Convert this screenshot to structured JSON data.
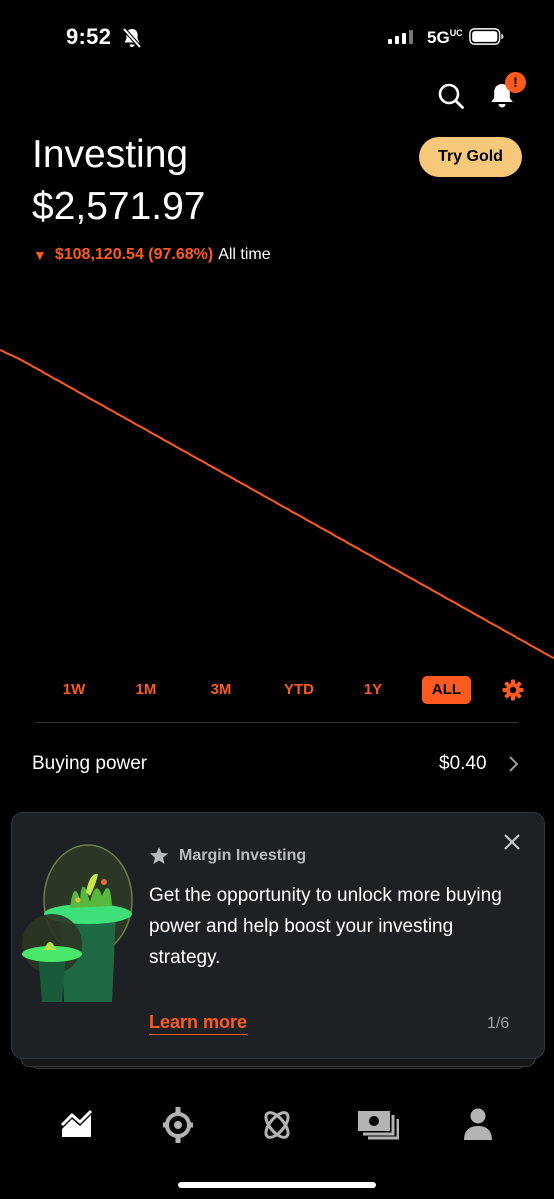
{
  "status_bar": {
    "time": "9:52",
    "network": "5G",
    "network_sub": "UC"
  },
  "header": {
    "title": "Investing",
    "gold_button": "Try Gold",
    "notification_badge": "!"
  },
  "portfolio": {
    "balance": "$2,571.97",
    "change": "$108,120.54 (97.68%)",
    "change_span": "All time",
    "direction": "down",
    "accent_color": "#ff5a1f"
  },
  "chart_data": {
    "type": "line",
    "title": "",
    "xlabel": "",
    "ylabel": "",
    "grid": false,
    "series": [
      {
        "values": [
          110.7,
          110.5,
          110.3,
          109.9,
          109.6,
          109.4,
          109.1,
          108.9,
          108.7,
          108.4,
          108.1,
          107.9,
          107.6,
          107.3,
          107.0,
          106.7,
          106.4,
          106.1,
          105.8,
          105.5,
          105.2,
          104.8,
          104.5,
          104.3,
          103.9,
          103.6,
          103.4,
          103.0,
          102.6,
          102.3,
          102.1,
          101.7,
          101.4,
          101.1,
          100.7,
          100.4,
          100.2,
          99.9,
          99.6,
          99.2,
          99.0,
          98.6,
          98.3,
          98.0,
          97.7,
          97.4,
          97.1,
          96.8,
          96.4,
          96.1,
          95.8,
          95.5,
          95.2,
          94.9,
          94.6,
          94.2,
          93.9,
          93.6,
          93.3,
          93.0,
          92.7,
          92.4,
          92.1,
          91.8,
          91.5,
          91.2,
          90.9,
          90.5,
          90.2,
          89.9,
          89.6,
          89.3,
          89.0,
          88.7,
          88.3,
          88.1,
          87.7,
          87.4,
          87.1,
          86.8,
          86.5,
          86.2,
          85.9,
          85.6,
          85.2,
          84.9,
          84.6,
          84.3,
          84.0,
          83.7,
          83.4,
          83.1,
          82.8,
          82.5,
          82.1,
          81.8,
          81.5,
          81.2,
          80.9,
          80.6,
          80.3,
          80.0,
          79.7,
          79.3,
          79.0,
          78.7,
          78.4,
          78.1,
          77.8,
          77.5,
          77.2,
          76.8,
          76.5,
          76.2,
          75.9,
          75.6,
          75.3,
          75.0,
          74.7,
          74.4,
          74.1,
          73.7,
          73.4,
          73.1,
          72.8,
          72.5,
          72.2,
          71.9,
          71.6,
          71.3,
          71.0,
          70.6,
          70.3,
          70.0,
          69.7,
          69.4,
          69.1,
          68.8,
          68.5,
          68.2,
          67.8,
          67.5,
          67.2,
          66.9,
          66.6,
          66.3,
          66.0,
          65.7,
          65.4,
          65.0,
          64.7,
          64.4,
          64.1,
          63.8,
          63.5,
          63.2,
          62.9,
          62.6,
          62.2,
          61.9,
          61.6,
          61.3,
          61.0,
          60.7,
          60.4,
          60.1,
          59.7,
          59.4,
          59.1,
          58.8,
          58.5,
          58.2,
          57.9,
          57.6,
          57.3,
          56.9,
          56.6,
          56.3,
          56.0,
          55.7,
          55.4,
          55.1,
          54.8,
          54.5,
          54.1,
          53.8,
          53.5,
          53.2,
          52.9,
          52.6,
          52.3,
          52.0,
          51.7,
          51.3,
          51.0,
          50.7,
          50.4,
          50.1,
          49.8,
          49.5,
          49.2,
          48.9,
          48.5,
          48.2,
          47.9,
          47.6,
          47.3,
          47.0,
          46.7,
          46.4,
          46.1,
          45.7,
          45.4,
          45.1,
          44.8,
          44.5,
          44.2,
          43.9,
          43.6,
          43.2,
          42.9,
          42.6,
          42.3,
          42.0,
          41.7,
          41.4,
          41.1,
          40.8,
          40.4,
          40.1,
          39.8,
          39.5,
          39.2,
          38.9,
          38.6,
          38.3,
          38.0,
          37.6,
          37.3,
          37.0,
          36.7,
          36.4,
          36.1,
          35.8,
          35.5,
          35.2,
          34.8,
          34.5,
          34.2,
          33.9,
          33.6,
          33.3,
          33.0,
          32.7,
          32.4,
          32.0,
          31.7,
          31.4,
          31.1,
          30.8,
          30.5,
          30.2,
          29.9,
          29.6,
          29.2,
          28.9,
          28.6,
          28.3,
          28.0,
          27.7,
          27.4,
          27.1,
          26.8,
          26.4,
          26.1,
          25.8,
          25.5,
          25.2,
          24.9,
          24.6,
          24.3,
          23.9,
          23.6,
          23.3,
          23.0,
          22.7,
          22.4,
          22.1,
          21.8,
          21.5,
          21.1,
          20.8,
          20.5,
          20.2,
          19.9,
          19.6,
          19.3,
          19.0,
          18.7,
          18.3,
          18.0,
          17.7,
          17.4,
          17.1,
          16.8,
          16.5,
          16.2,
          15.9,
          15.5,
          15.2,
          14.9,
          14.6,
          14.3,
          14.0,
          13.7,
          13.4,
          13.1,
          12.7,
          12.4,
          12.1,
          11.8,
          11.5,
          11.2,
          10.9,
          10.6,
          10.3,
          9.9,
          9.6,
          9.3,
          9.0,
          8.7,
          8.4,
          8.1,
          7.8,
          7.4,
          7.1,
          6.8,
          6.5,
          6.2,
          5.9,
          5.6,
          5.3,
          5.0,
          4.6,
          4.3,
          4.0,
          3.7,
          3.4,
          3.1,
          2.8,
          2.6
        ]
      }
    ]
  },
  "ranges": {
    "items": [
      {
        "label": "1W"
      },
      {
        "label": "1M"
      },
      {
        "label": "3M"
      },
      {
        "label": "YTD"
      },
      {
        "label": "1Y"
      },
      {
        "label": "ALL",
        "active": true
      }
    ]
  },
  "buying_power": {
    "label": "Buying power",
    "value": "$0.40"
  },
  "promo": {
    "kicker": "Margin Investing",
    "body": "Get the opportunity to unlock more buying power and help boost your investing strategy.",
    "link": "Learn more",
    "page": "1/6"
  },
  "nav": {
    "items": [
      {
        "icon": "chart-icon",
        "active": true
      },
      {
        "icon": "crypto-icon"
      },
      {
        "icon": "atom-icon"
      },
      {
        "icon": "cash-icon"
      },
      {
        "icon": "person-icon"
      }
    ]
  }
}
